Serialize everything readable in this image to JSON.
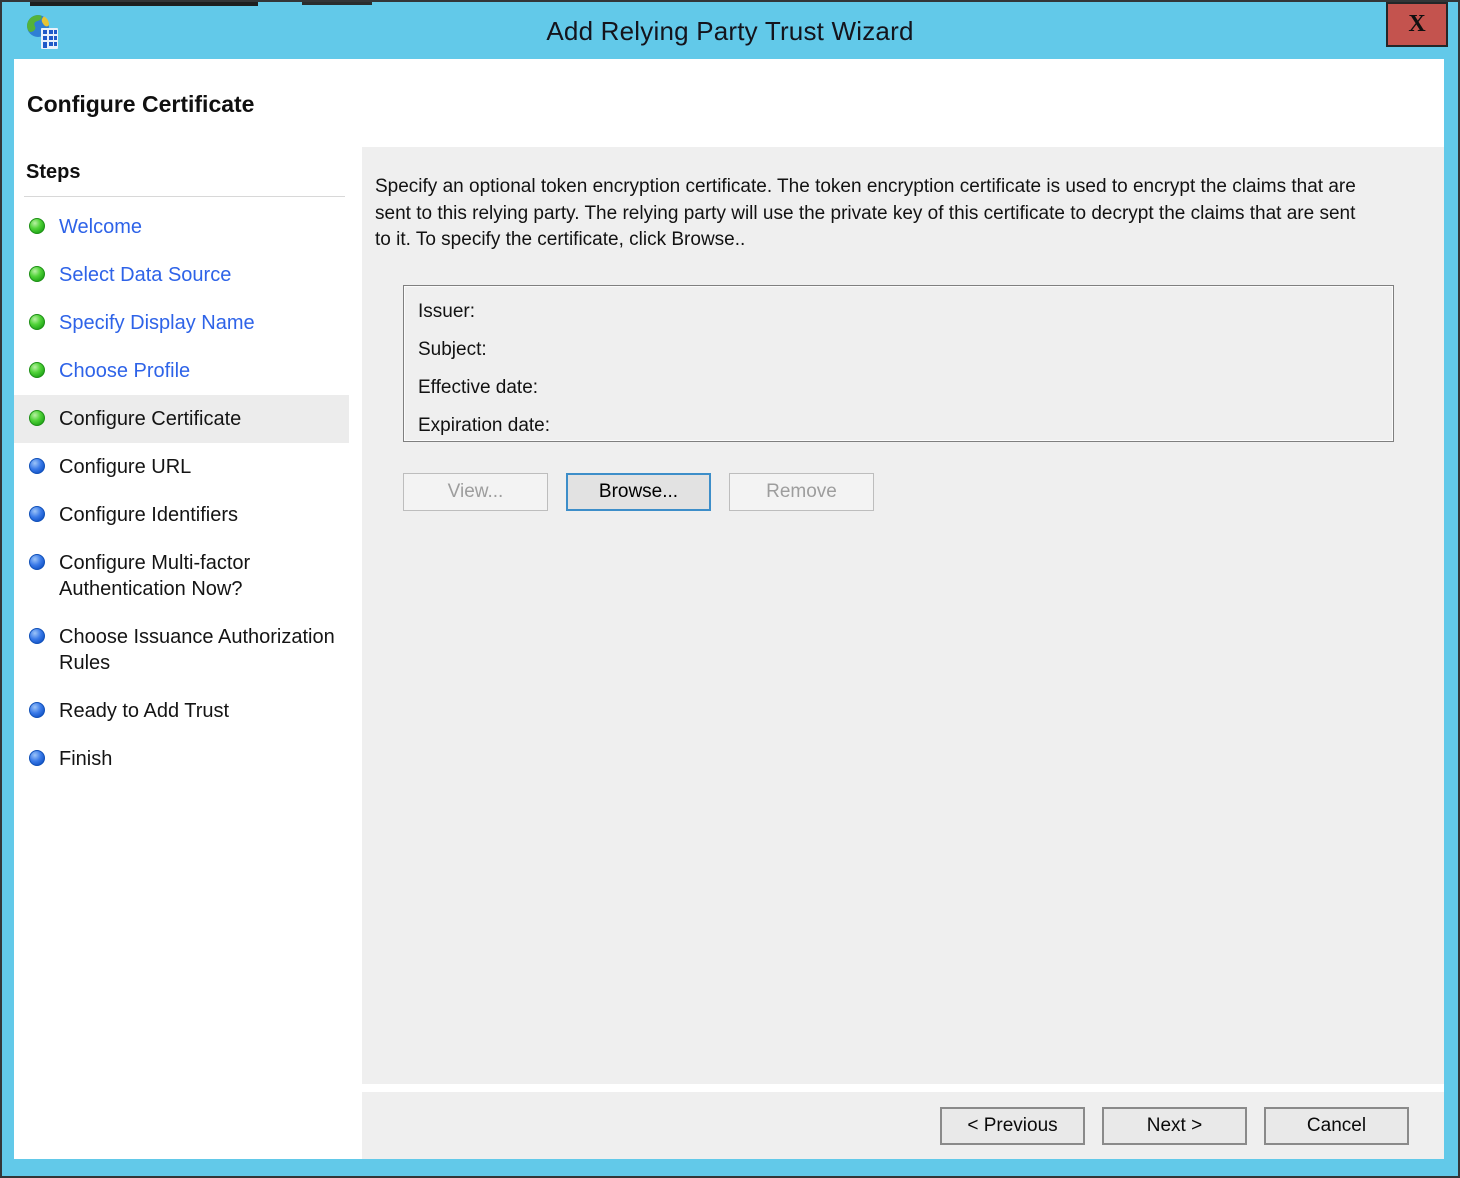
{
  "window": {
    "title": "Add Relying Party Trust Wizard",
    "close_label": "X"
  },
  "page": {
    "heading": "Configure Certificate"
  },
  "sidebar": {
    "heading": "Steps",
    "items": [
      {
        "label": "Welcome",
        "state": "done"
      },
      {
        "label": "Select Data Source",
        "state": "done"
      },
      {
        "label": "Specify Display Name",
        "state": "done"
      },
      {
        "label": "Choose Profile",
        "state": "done"
      },
      {
        "label": "Configure Certificate",
        "state": "current"
      },
      {
        "label": "Configure URL",
        "state": "todo"
      },
      {
        "label": "Configure Identifiers",
        "state": "todo"
      },
      {
        "label": "Configure Multi-factor Authentication Now?",
        "state": "todo"
      },
      {
        "label": "Choose Issuance Authorization Rules",
        "state": "todo"
      },
      {
        "label": "Ready to Add Trust",
        "state": "todo"
      },
      {
        "label": "Finish",
        "state": "todo"
      }
    ]
  },
  "main": {
    "description": "Specify an optional token encryption certificate.  The token encryption certificate is used to encrypt the claims that are sent to this relying party.  The relying party will use the private key of this certificate to decrypt the claims that are sent to it.  To specify the certificate, click Browse..",
    "certificate_fields": [
      {
        "label": "Issuer:",
        "value": ""
      },
      {
        "label": "Subject:",
        "value": ""
      },
      {
        "label": "Effective date:",
        "value": ""
      },
      {
        "label": "Expiration date:",
        "value": ""
      }
    ],
    "buttons": {
      "view": "View...",
      "browse": "Browse...",
      "remove": "Remove"
    }
  },
  "footer": {
    "previous": "< Previous",
    "next": "Next >",
    "cancel": "Cancel"
  },
  "colors": {
    "titlebar_blue": "#62c9e9",
    "close_red": "#c4534e",
    "link_blue": "#2e63e8",
    "done_bullet_green": "#2fba24",
    "todo_bullet_blue": "#2061d2",
    "content_gray": "#efefef",
    "current_step_highlight": "#ececec",
    "focused_button_border": "#3d8ec9"
  }
}
